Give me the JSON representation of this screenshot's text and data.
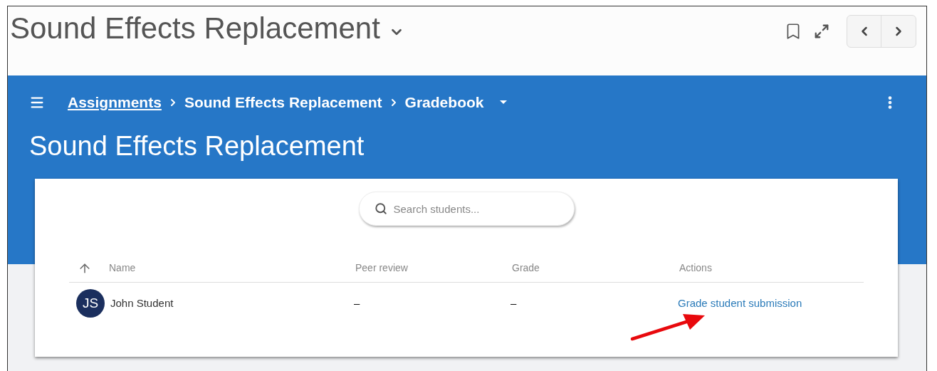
{
  "window": {
    "title": "Sound Effects Replacement"
  },
  "breadcrumbs": [
    {
      "label": "Assignments",
      "link": true
    },
    {
      "label": "Sound Effects Replacement",
      "link": false
    },
    {
      "label": "Gradebook",
      "link": false
    }
  ],
  "page_title": "Sound Effects Replacement",
  "search": {
    "placeholder": "Search students..."
  },
  "table": {
    "columns": [
      "Name",
      "Peer review",
      "Grade",
      "Actions"
    ],
    "rows": [
      {
        "initials": "JS",
        "name": "John Student",
        "peer_review": "–",
        "grade": "–",
        "action": "Grade student submission"
      }
    ]
  }
}
